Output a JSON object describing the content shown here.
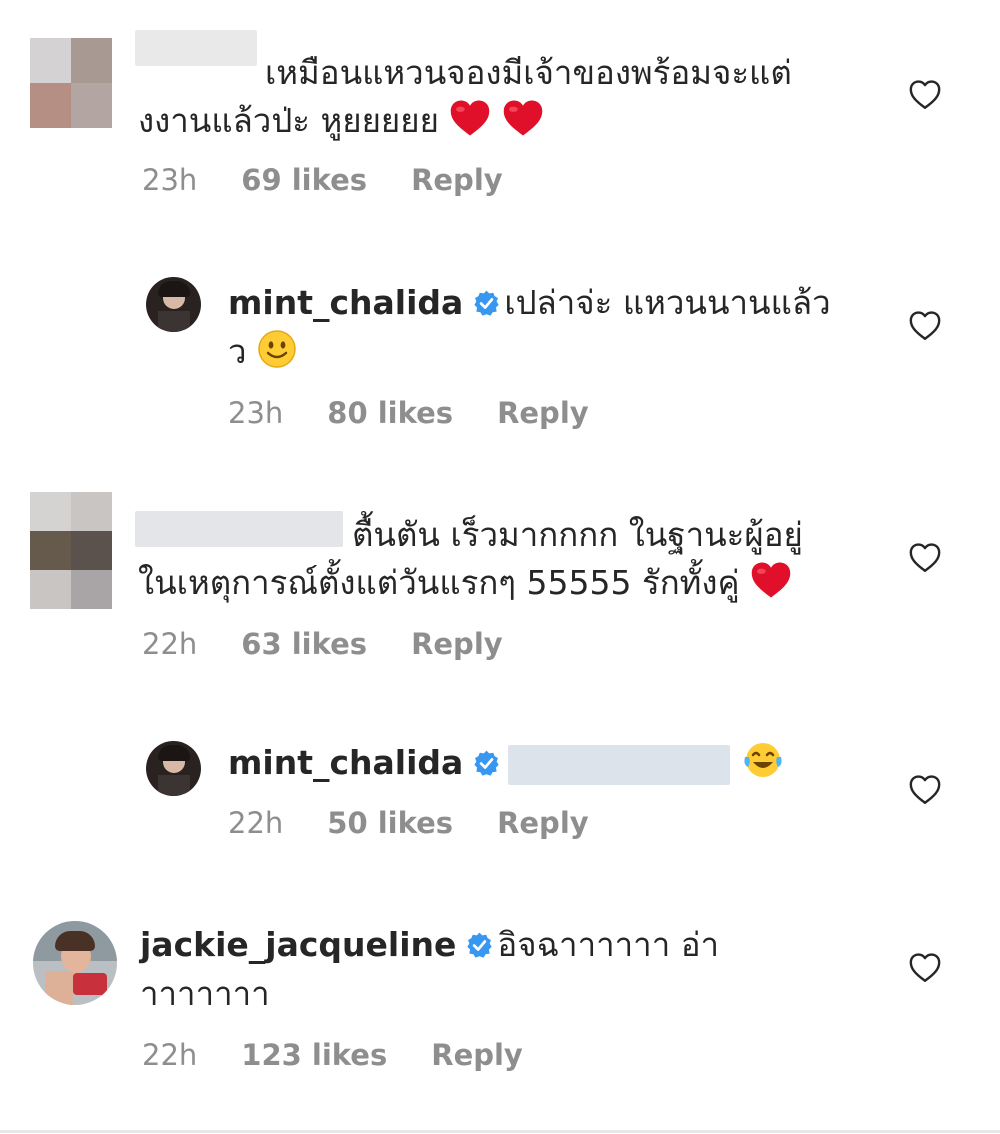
{
  "comments": [
    {
      "username": "",
      "line1": "เหมือนแหวนจองมีเจ้าของพร้อมจะแต่",
      "line2": "งงานแล้วป่ะ หูยยยยย",
      "time": "23h",
      "likes": "69 likes",
      "reply": "Reply"
    },
    {
      "username": "mint_chalida",
      "line1": "เปล่าจ่ะ แหวนนานแล้ว",
      "line2": "ว",
      "time": "23h",
      "likes": "80 likes",
      "reply": "Reply"
    },
    {
      "username": "",
      "line1": "ตื้นตัน เร็วมากกกก ในฐานะผู้อยู่",
      "line2": "ในเหตุการณ์ตั้งแต่วันแรกๆ 55555 รักทั้งคู่",
      "time": "22h",
      "likes": "63 likes",
      "reply": "Reply"
    },
    {
      "username": "mint_chalida",
      "line1": "",
      "time": "22h",
      "likes": "50 likes",
      "reply": "Reply"
    },
    {
      "username": "jackie_jacqueline",
      "line1": "อิจฉาาาาาา  อ่า",
      "line2": "าาาาาาา",
      "time": "22h",
      "likes": "123 likes",
      "reply": "Reply"
    }
  ],
  "icons": {
    "like": "heart-outline-icon",
    "verified": "verified-badge-icon",
    "emoji_heart": "red-heart-emoji",
    "emoji_smile": "slightly-smiling-face-emoji",
    "emoji_laugh": "face-with-tears-of-joy-emoji"
  },
  "colors": {
    "text": "#262626",
    "meta": "#8e8e8e",
    "verified": "#3897f0",
    "heart_emoji": "#e0102a"
  }
}
